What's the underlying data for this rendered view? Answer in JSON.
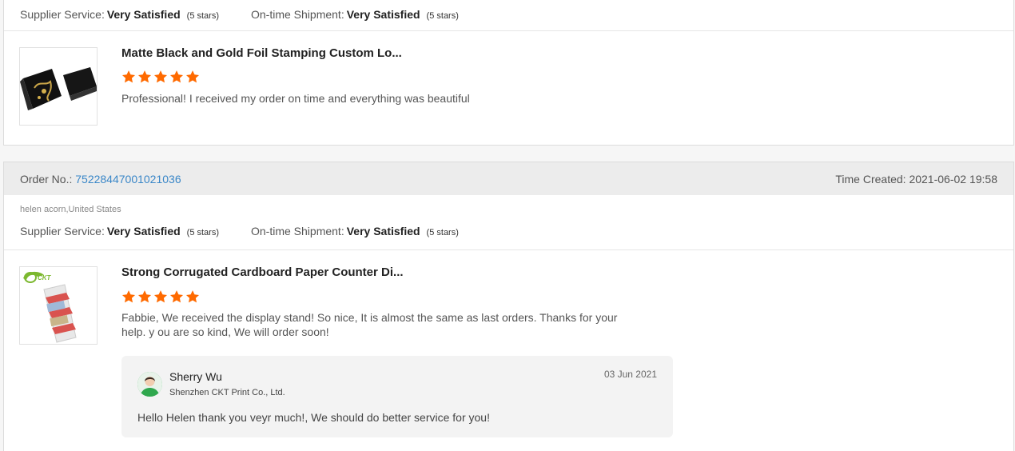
{
  "labels": {
    "supplier_service": "Supplier Service:",
    "ontime_shipment": "On-time Shipment:",
    "order_no": "Order No.:",
    "time_created": "Time Created:"
  },
  "reviews": [
    {
      "ratings": {
        "supplier_service": "Very Satisfied",
        "supplier_service_stars": "(5 stars)",
        "ontime_shipment": "Very Satisfied",
        "ontime_shipment_stars": "(5 stars)"
      },
      "product_title": "Matte Black and Gold Foil Stamping Custom Lo...",
      "star_rating": 5,
      "comment": "Professional! I received my order on time and everything was beautiful"
    },
    {
      "order_no": "75228447001021036",
      "time_created": "2021-06-02 19:58",
      "buyer": "helen acorn,United States",
      "ratings": {
        "supplier_service": "Very Satisfied",
        "supplier_service_stars": "(5 stars)",
        "ontime_shipment": "Very Satisfied",
        "ontime_shipment_stars": "(5 stars)"
      },
      "product_title": "Strong Corrugated Cardboard Paper Counter Di...",
      "star_rating": 5,
      "comment": "Fabbie, We received the display stand! So nice, It is almost the same as last orders. Thanks for your help. y ou are so kind, We will order soon!",
      "reply": {
        "name": "Sherry Wu",
        "company": "Shenzhen CKT Print Co., Ltd.",
        "date": "03 Jun 2021",
        "text": "Hello Helen thank you veyr much!, We should do better service for you!"
      }
    }
  ],
  "colors": {
    "star": "#ff6a00",
    "link": "#3a87c8",
    "order_bar": "#ececec"
  }
}
